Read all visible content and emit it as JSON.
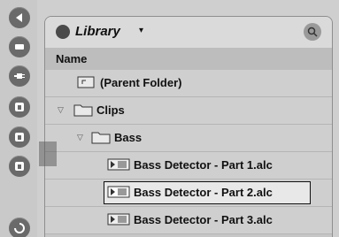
{
  "browser": {
    "title": "Library",
    "caret": "▾",
    "column_header": "Name",
    "rows": [
      {
        "label": "(Parent Folder)"
      },
      {
        "label": "Clips"
      },
      {
        "label": "Bass"
      },
      {
        "label": "Bass Detector - Part 1.alc"
      },
      {
        "label": "Bass Detector - Part 2.alc"
      },
      {
        "label": "Bass Detector - Part 3.alc"
      }
    ]
  },
  "icons": {
    "selector": [
      "back-arrow-icon",
      "device-icon",
      "plugin-icon",
      "disk-icon-1",
      "disk-icon-2",
      "disk-icon-3",
      "refresh-icon"
    ],
    "library": "library-icon",
    "search": "search-icon"
  }
}
